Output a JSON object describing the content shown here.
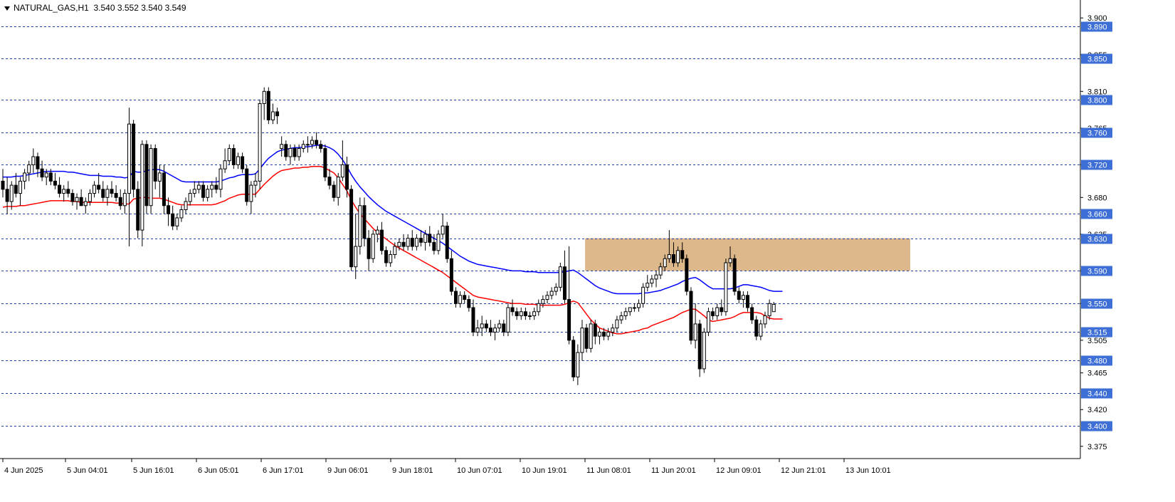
{
  "window": {
    "symbol_label": "NATURAL_GAS,H1",
    "ohlc_label": "3.540 3.552 3.540 3.549"
  },
  "colors": {
    "background": "#ffffff",
    "level_line": "#1c3fa8",
    "level_label_bg": "#3d6fd6",
    "ma_fast": "#ff0000",
    "ma_slow": "#0000ff",
    "zone": "#ddb88a",
    "candle": "#000000"
  },
  "chart_data": {
    "type": "candlestick",
    "ylim": [
      3.36,
      3.915
    ],
    "y_ticks": [
      "3.900",
      "3.855",
      "3.810",
      "3.765",
      "3.720",
      "3.680",
      "3.635",
      "3.590",
      "3.550",
      "3.505",
      "3.465",
      "3.420",
      "3.375"
    ],
    "levels": [
      "3.890",
      "3.850",
      "3.800",
      "3.760",
      "3.720",
      "3.660",
      "3.630",
      "3.590",
      "3.550",
      "3.515",
      "3.480",
      "3.440",
      "3.400"
    ],
    "x_labels": [
      "4 Jun 2025",
      "5 Jun 04:01",
      "5 Jun 16:01",
      "6 Jun 05:01",
      "6 Jun 17:01",
      "9 Jun 06:01",
      "9 Jun 18:01",
      "10 Jun 07:01",
      "10 Jun 19:01",
      "11 Jun 08:01",
      "11 Jun 20:01",
      "12 Jun 09:01",
      "12 Jun 21:01",
      "13 Jun 10:01"
    ],
    "zone": {
      "from_bar": 134,
      "to_bar": 208,
      "low": 3.59,
      "high": 3.63
    },
    "candles": [
      [
        3.7,
        3.715,
        3.68,
        3.69
      ],
      [
        3.69,
        3.705,
        3.66,
        3.675
      ],
      [
        3.675,
        3.7,
        3.665,
        3.695
      ],
      [
        3.695,
        3.71,
        3.68,
        3.685
      ],
      [
        3.685,
        3.705,
        3.67,
        3.7
      ],
      [
        3.7,
        3.715,
        3.69,
        3.71
      ],
      [
        3.71,
        3.725,
        3.7,
        3.72
      ],
      [
        3.72,
        3.74,
        3.71,
        3.73
      ],
      [
        3.73,
        3.735,
        3.705,
        3.715
      ],
      [
        3.715,
        3.725,
        3.7,
        3.705
      ],
      [
        3.705,
        3.715,
        3.695,
        3.71
      ],
      [
        3.71,
        3.715,
        3.695,
        3.7
      ],
      [
        3.7,
        3.71,
        3.69,
        3.695
      ],
      [
        3.695,
        3.705,
        3.68,
        3.685
      ],
      [
        3.685,
        3.695,
        3.675,
        3.69
      ],
      [
        3.69,
        3.7,
        3.68,
        3.685
      ],
      [
        3.685,
        3.69,
        3.67,
        3.675
      ],
      [
        3.675,
        3.685,
        3.665,
        3.68
      ],
      [
        3.68,
        3.69,
        3.67,
        3.67
      ],
      [
        3.67,
        3.68,
        3.66,
        3.675
      ],
      [
        3.675,
        3.69,
        3.67,
        3.685
      ],
      [
        3.685,
        3.7,
        3.68,
        3.695
      ],
      [
        3.695,
        3.71,
        3.685,
        3.69
      ],
      [
        3.69,
        3.7,
        3.675,
        3.68
      ],
      [
        3.68,
        3.695,
        3.67,
        3.69
      ],
      [
        3.69,
        3.7,
        3.68,
        3.685
      ],
      [
        3.685,
        3.695,
        3.675,
        3.68
      ],
      [
        3.68,
        3.69,
        3.665,
        3.67
      ],
      [
        3.67,
        3.69,
        3.66,
        3.685
      ],
      [
        3.685,
        3.79,
        3.62,
        3.77
      ],
      [
        3.77,
        3.775,
        3.68,
        3.69
      ],
      [
        3.69,
        3.7,
        3.63,
        3.64
      ],
      [
        3.64,
        3.75,
        3.62,
        3.745
      ],
      [
        3.745,
        3.75,
        3.66,
        3.67
      ],
      [
        3.67,
        3.745,
        3.66,
        3.74
      ],
      [
        3.74,
        3.745,
        3.69,
        3.7
      ],
      [
        3.7,
        3.72,
        3.68,
        3.71
      ],
      [
        3.71,
        3.72,
        3.66,
        3.67
      ],
      [
        3.67,
        3.68,
        3.645,
        3.66
      ],
      [
        3.66,
        3.67,
        3.64,
        3.645
      ],
      [
        3.645,
        3.66,
        3.64,
        3.655
      ],
      [
        3.655,
        3.67,
        3.65,
        3.665
      ],
      [
        3.665,
        3.68,
        3.66,
        3.675
      ],
      [
        3.675,
        3.69,
        3.67,
        3.685
      ],
      [
        3.685,
        3.7,
        3.68,
        3.69
      ],
      [
        3.69,
        3.7,
        3.685,
        3.695
      ],
      [
        3.695,
        3.7,
        3.675,
        3.68
      ],
      [
        3.68,
        3.695,
        3.675,
        3.69
      ],
      [
        3.69,
        3.7,
        3.68,
        3.695
      ],
      [
        3.695,
        3.705,
        3.685,
        3.69
      ],
      [
        3.69,
        3.72,
        3.68,
        3.715
      ],
      [
        3.715,
        3.74,
        3.71,
        3.725
      ],
      [
        3.725,
        3.745,
        3.72,
        3.74
      ],
      [
        3.74,
        3.745,
        3.715,
        3.72
      ],
      [
        3.72,
        3.735,
        3.715,
        3.73
      ],
      [
        3.73,
        3.735,
        3.71,
        3.715
      ],
      [
        3.715,
        3.72,
        3.67,
        3.675
      ],
      [
        3.675,
        3.7,
        3.66,
        3.695
      ],
      [
        3.695,
        3.71,
        3.68,
        3.7
      ],
      [
        3.7,
        3.8,
        3.69,
        3.795
      ],
      [
        3.795,
        3.815,
        3.775,
        3.81
      ],
      [
        3.81,
        3.815,
        3.77,
        3.775
      ],
      [
        3.775,
        3.795,
        3.77,
        3.785
      ],
      [
        3.785,
        3.79,
        3.77,
        3.78
      ],
      [
        3.74,
        3.755,
        3.73,
        3.745
      ],
      [
        3.745,
        3.75,
        3.725,
        3.73
      ],
      [
        3.73,
        3.745,
        3.72,
        3.74
      ],
      [
        3.74,
        3.745,
        3.725,
        3.73
      ],
      [
        3.73,
        3.745,
        3.725,
        3.74
      ],
      [
        3.74,
        3.75,
        3.735,
        3.745
      ],
      [
        3.745,
        3.755,
        3.735,
        3.745
      ],
      [
        3.745,
        3.755,
        3.74,
        3.75
      ],
      [
        3.75,
        3.76,
        3.74,
        3.745
      ],
      [
        3.745,
        3.75,
        3.735,
        3.74
      ],
      [
        3.74,
        3.745,
        3.7,
        3.705
      ],
      [
        3.705,
        3.715,
        3.69,
        3.695
      ],
      [
        3.695,
        3.7,
        3.675,
        3.68
      ],
      [
        3.68,
        3.71,
        3.67,
        3.705
      ],
      [
        3.705,
        3.75,
        3.7,
        3.72
      ],
      [
        3.72,
        3.73,
        3.68,
        3.69
      ],
      [
        3.69,
        3.695,
        3.59,
        3.595
      ],
      [
        3.595,
        3.66,
        3.58,
        3.62
      ],
      [
        3.62,
        3.68,
        3.61,
        3.67
      ],
      [
        3.67,
        3.68,
        3.62,
        3.63
      ],
      [
        3.63,
        3.64,
        3.59,
        3.605
      ],
      [
        3.605,
        3.64,
        3.6,
        3.635
      ],
      [
        3.635,
        3.645,
        3.625,
        3.64
      ],
      [
        3.64,
        3.65,
        3.61,
        3.615
      ],
      [
        3.615,
        3.62,
        3.595,
        3.6
      ],
      [
        3.6,
        3.615,
        3.595,
        3.61
      ],
      [
        3.61,
        3.625,
        3.605,
        3.62
      ],
      [
        3.62,
        3.63,
        3.615,
        3.625
      ],
      [
        3.625,
        3.635,
        3.615,
        3.62
      ],
      [
        3.62,
        3.635,
        3.615,
        3.63
      ],
      [
        3.63,
        3.64,
        3.615,
        3.62
      ],
      [
        3.62,
        3.635,
        3.615,
        3.63
      ],
      [
        3.63,
        3.64,
        3.62,
        3.625
      ],
      [
        3.625,
        3.64,
        3.615,
        3.635
      ],
      [
        3.635,
        3.645,
        3.62,
        3.625
      ],
      [
        3.625,
        3.635,
        3.61,
        3.615
      ],
      [
        3.615,
        3.64,
        3.61,
        3.635
      ],
      [
        3.635,
        3.66,
        3.63,
        3.645
      ],
      [
        3.645,
        3.65,
        3.6,
        3.605
      ],
      [
        3.605,
        3.615,
        3.56,
        3.565
      ],
      [
        3.565,
        3.57,
        3.545,
        3.55
      ],
      [
        3.55,
        3.565,
        3.545,
        3.56
      ],
      [
        3.56,
        3.565,
        3.55,
        3.555
      ],
      [
        3.555,
        3.56,
        3.54,
        3.545
      ],
      [
        3.545,
        3.555,
        3.51,
        3.515
      ],
      [
        3.515,
        3.53,
        3.51,
        3.52
      ],
      [
        3.52,
        3.535,
        3.51,
        3.525
      ],
      [
        3.525,
        3.53,
        3.515,
        3.52
      ],
      [
        3.52,
        3.53,
        3.51,
        3.515
      ],
      [
        3.515,
        3.525,
        3.505,
        3.52
      ],
      [
        3.52,
        3.53,
        3.515,
        3.525
      ],
      [
        3.525,
        3.53,
        3.51,
        3.515
      ],
      [
        3.515,
        3.55,
        3.51,
        3.545
      ],
      [
        3.545,
        3.555,
        3.535,
        3.54
      ],
      [
        3.54,
        3.545,
        3.53,
        3.535
      ],
      [
        3.535,
        3.545,
        3.53,
        3.54
      ],
      [
        3.54,
        3.545,
        3.53,
        3.535
      ],
      [
        3.535,
        3.54,
        3.53,
        3.535
      ],
      [
        3.535,
        3.545,
        3.53,
        3.54
      ],
      [
        3.54,
        3.555,
        3.535,
        3.55
      ],
      [
        3.55,
        3.56,
        3.545,
        3.555
      ],
      [
        3.555,
        3.565,
        3.55,
        3.56
      ],
      [
        3.56,
        3.57,
        3.555,
        3.565
      ],
      [
        3.565,
        3.575,
        3.56,
        3.57
      ],
      [
        3.57,
        3.6,
        3.565,
        3.595
      ],
      [
        3.595,
        3.615,
        3.55,
        3.555
      ],
      [
        3.555,
        3.62,
        3.5,
        3.505
      ],
      [
        3.505,
        3.51,
        3.455,
        3.46
      ],
      [
        3.46,
        3.5,
        3.45,
        3.49
      ],
      [
        3.49,
        3.53,
        3.48,
        3.52
      ],
      [
        3.52,
        3.525,
        3.49,
        3.495
      ],
      [
        3.495,
        3.53,
        3.49,
        3.525
      ],
      [
        3.525,
        3.53,
        3.5,
        3.51
      ],
      [
        3.51,
        3.52,
        3.5,
        3.515
      ],
      [
        3.515,
        3.52,
        3.505,
        3.51
      ],
      [
        3.51,
        3.52,
        3.505,
        3.515
      ],
      [
        3.515,
        3.525,
        3.51,
        3.52
      ],
      [
        3.52,
        3.535,
        3.515,
        3.53
      ],
      [
        3.53,
        3.54,
        3.525,
        3.535
      ],
      [
        3.535,
        3.545,
        3.53,
        3.54
      ],
      [
        3.54,
        3.545,
        3.535,
        3.545
      ],
      [
        3.545,
        3.55,
        3.54,
        3.545
      ],
      [
        3.545,
        3.555,
        3.54,
        3.55
      ],
      [
        3.55,
        3.575,
        3.545,
        3.57
      ],
      [
        3.57,
        3.585,
        3.565,
        3.575
      ],
      [
        3.575,
        3.585,
        3.57,
        3.58
      ],
      [
        3.58,
        3.59,
        3.57,
        3.585
      ],
      [
        3.585,
        3.6,
        3.58,
        3.595
      ],
      [
        3.595,
        3.61,
        3.59,
        3.605
      ],
      [
        3.605,
        3.64,
        3.6,
        3.61
      ],
      [
        3.61,
        3.625,
        3.595,
        3.6
      ],
      [
        3.6,
        3.62,
        3.595,
        3.615
      ],
      [
        3.615,
        3.625,
        3.6,
        3.605
      ],
      [
        3.605,
        3.61,
        3.56,
        3.565
      ],
      [
        3.565,
        3.57,
        3.5,
        3.505
      ],
      [
        3.505,
        3.55,
        3.495,
        3.525
      ],
      [
        3.525,
        3.53,
        3.46,
        3.47
      ],
      [
        3.47,
        3.52,
        3.465,
        3.515
      ],
      [
        3.515,
        3.545,
        3.51,
        3.54
      ],
      [
        3.54,
        3.545,
        3.53,
        3.535
      ],
      [
        3.535,
        3.55,
        3.53,
        3.545
      ],
      [
        3.545,
        3.555,
        3.535,
        3.54
      ],
      [
        3.54,
        3.605,
        3.535,
        3.6
      ],
      [
        3.6,
        3.62,
        3.595,
        3.605
      ],
      [
        3.605,
        3.61,
        3.56,
        3.565
      ],
      [
        3.565,
        3.57,
        3.55,
        3.555
      ],
      [
        3.555,
        3.565,
        3.545,
        3.56
      ],
      [
        3.56,
        3.565,
        3.54,
        3.545
      ],
      [
        3.545,
        3.55,
        3.525,
        3.53
      ],
      [
        3.53,
        3.535,
        3.505,
        3.51
      ],
      [
        3.51,
        3.53,
        3.505,
        3.525
      ],
      [
        3.525,
        3.54,
        3.52,
        3.535
      ],
      [
        3.535,
        3.555,
        3.53,
        3.55
      ],
      [
        3.54,
        3.552,
        3.54,
        3.549
      ]
    ],
    "ma_fast": [
      3.668,
      3.669,
      3.669,
      3.669,
      3.67,
      3.67,
      3.671,
      3.672,
      3.673,
      3.674,
      3.675,
      3.676,
      3.676,
      3.676,
      3.676,
      3.676,
      3.675,
      3.675,
      3.674,
      3.674,
      3.674,
      3.674,
      3.674,
      3.674,
      3.674,
      3.674,
      3.673,
      3.673,
      3.672,
      3.672,
      3.678,
      3.679,
      3.68,
      3.68,
      3.679,
      3.679,
      3.679,
      3.678,
      3.676,
      3.674,
      3.672,
      3.671,
      3.671,
      3.671,
      3.671,
      3.671,
      3.671,
      3.671,
      3.671,
      3.672,
      3.674,
      3.676,
      3.679,
      3.681,
      3.683,
      3.684,
      3.684,
      3.684,
      3.684,
      3.69,
      3.696,
      3.701,
      3.706,
      3.71,
      3.713,
      3.714,
      3.715,
      3.716,
      3.716,
      3.717,
      3.717,
      3.718,
      3.718,
      3.718,
      3.716,
      3.713,
      3.71,
      3.704,
      3.696,
      3.688,
      3.677,
      3.668,
      3.66,
      3.654,
      3.648,
      3.642,
      3.637,
      3.633,
      3.629,
      3.625,
      3.621,
      3.618,
      3.615,
      3.612,
      3.609,
      3.606,
      3.603,
      3.6,
      3.597,
      3.594,
      3.591,
      3.588,
      3.584,
      3.58,
      3.576,
      3.572,
      3.568,
      3.564,
      3.56,
      3.558,
      3.557,
      3.556,
      3.555,
      3.554,
      3.553,
      3.552,
      3.551,
      3.55,
      3.55,
      3.55,
      3.549,
      3.549,
      3.549,
      3.548,
      3.548,
      3.548,
      3.548,
      3.548,
      3.548,
      3.549,
      3.551,
      3.553,
      3.551,
      3.544,
      3.537,
      3.53,
      3.525,
      3.52,
      3.518,
      3.516,
      3.514,
      3.513,
      3.513,
      3.514,
      3.515,
      3.516,
      3.517,
      3.519,
      3.52,
      3.523,
      3.525,
      3.527,
      3.529,
      3.531,
      3.533,
      3.536,
      3.539,
      3.541,
      3.543,
      3.543,
      3.539,
      3.535,
      3.53,
      3.528,
      3.529,
      3.53,
      3.531,
      3.532,
      3.534,
      3.537,
      3.539,
      3.539,
      3.539,
      3.539,
      3.538,
      3.535,
      3.532,
      3.531,
      3.531,
      3.531
    ],
    "ma_slow": [
      3.705,
      3.705,
      3.705,
      3.706,
      3.706,
      3.707,
      3.708,
      3.709,
      3.71,
      3.711,
      3.712,
      3.712,
      3.712,
      3.712,
      3.712,
      3.711,
      3.711,
      3.71,
      3.709,
      3.708,
      3.707,
      3.707,
      3.707,
      3.706,
      3.706,
      3.706,
      3.705,
      3.705,
      3.704,
      3.705,
      3.712,
      3.711,
      3.711,
      3.713,
      3.714,
      3.714,
      3.714,
      3.712,
      3.709,
      3.706,
      3.703,
      3.7,
      3.699,
      3.699,
      3.699,
      3.699,
      3.699,
      3.699,
      3.699,
      3.699,
      3.7,
      3.702,
      3.704,
      3.705,
      3.707,
      3.708,
      3.708,
      3.708,
      3.709,
      3.715,
      3.722,
      3.728,
      3.732,
      3.736,
      3.738,
      3.739,
      3.74,
      3.741,
      3.741,
      3.742,
      3.742,
      3.743,
      3.744,
      3.744,
      3.743,
      3.741,
      3.738,
      3.733,
      3.726,
      3.718,
      3.708,
      3.7,
      3.693,
      3.687,
      3.681,
      3.676,
      3.671,
      3.667,
      3.663,
      3.66,
      3.657,
      3.654,
      3.651,
      3.648,
      3.645,
      3.642,
      3.639,
      3.636,
      3.633,
      3.63,
      3.627,
      3.624,
      3.62,
      3.616,
      3.612,
      3.608,
      3.605,
      3.602,
      3.6,
      3.598,
      3.597,
      3.596,
      3.595,
      3.594,
      3.593,
      3.592,
      3.591,
      3.59,
      3.59,
      3.59,
      3.589,
      3.589,
      3.589,
      3.588,
      3.588,
      3.588,
      3.588,
      3.588,
      3.588,
      3.589,
      3.59,
      3.591,
      3.588,
      3.584,
      3.58,
      3.576,
      3.572,
      3.569,
      3.567,
      3.565,
      3.563,
      3.562,
      3.562,
      3.562,
      3.562,
      3.562,
      3.562,
      3.563,
      3.563,
      3.564,
      3.565,
      3.566,
      3.568,
      3.57,
      3.572,
      3.574,
      3.577,
      3.579,
      3.581,
      3.582,
      3.579,
      3.575,
      3.571,
      3.568,
      3.568,
      3.568,
      3.568,
      3.568,
      3.569,
      3.571,
      3.573,
      3.573,
      3.572,
      3.571,
      3.57,
      3.568,
      3.566,
      3.565,
      3.565,
      3.565
    ]
  }
}
